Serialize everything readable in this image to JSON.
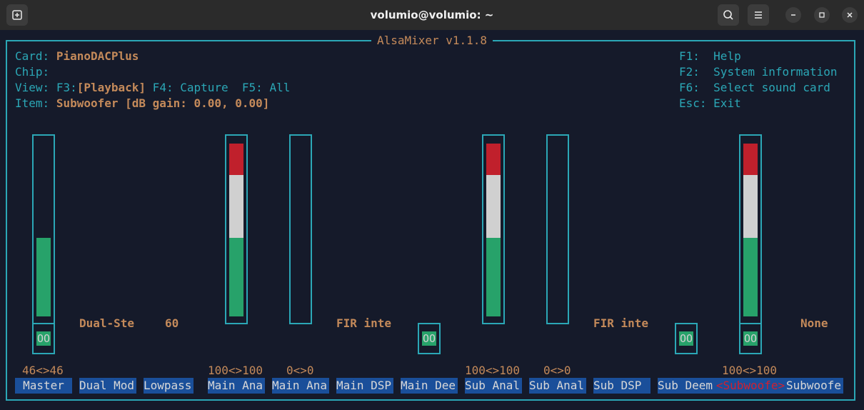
{
  "window": {
    "title": "volumio@volumio: ~"
  },
  "mixer": {
    "title": "AlsaMixer v1.1.8",
    "card_label": "Card:",
    "card_value": "PianoDACPlus",
    "chip_label": "Chip:",
    "view_label": "View:",
    "view_f3": "F3:",
    "view_playback": "[Playback]",
    "view_f4": " F4: Capture  F5: All",
    "item_label": "Item:",
    "item_value": "Subwoofer [dB gain: 0.00, 0.00]",
    "help": [
      {
        "key": "F1:",
        "text": "Help"
      },
      {
        "key": "F2:",
        "text": "System information"
      },
      {
        "key": "F6:",
        "text": "Select sound card"
      },
      {
        "key": "Esc:",
        "text": "Exit"
      }
    ]
  },
  "controls": [
    {
      "name": "Master",
      "value": "46<>46",
      "level": 0.46,
      "mute": "OO"
    },
    {
      "name": "Dual Mod",
      "enum": "Dual-Ste"
    },
    {
      "name": "Lowpass",
      "enum": "60"
    },
    {
      "name": "Main Ana",
      "value": "100<>100",
      "level": 1.0
    },
    {
      "name": "Main Ana",
      "value": "0<>0",
      "level": 0.0
    },
    {
      "name": "Main DSP",
      "enum": "FIR inte"
    },
    {
      "name": "Main Dee",
      "mute": "OO"
    },
    {
      "name": "Sub Anal",
      "value": "100<>100",
      "level": 1.0
    },
    {
      "name": "Sub Anal",
      "value": "0<>0",
      "level": 0.0
    },
    {
      "name": "Sub DSP",
      "enum": "FIR inte"
    },
    {
      "name": "Sub Deem",
      "mute": "OO"
    },
    {
      "name": "Subwoofe",
      "value": "100<>100",
      "level": 1.0,
      "mute": "OO",
      "selected": true
    },
    {
      "name": "Subwoofe",
      "enum": "None"
    }
  ],
  "selection_brackets": {
    "left": "<",
    "right": ">"
  },
  "colors": {
    "frame": "#2ba7b6",
    "label": "#2ba7b6",
    "value": "#c48a5a",
    "bar_green": "#27a26a",
    "bar_white": "#d0d0d0",
    "bar_red": "#c0202c",
    "name_bg": "#1a4f9a",
    "selected": "#d02030"
  }
}
